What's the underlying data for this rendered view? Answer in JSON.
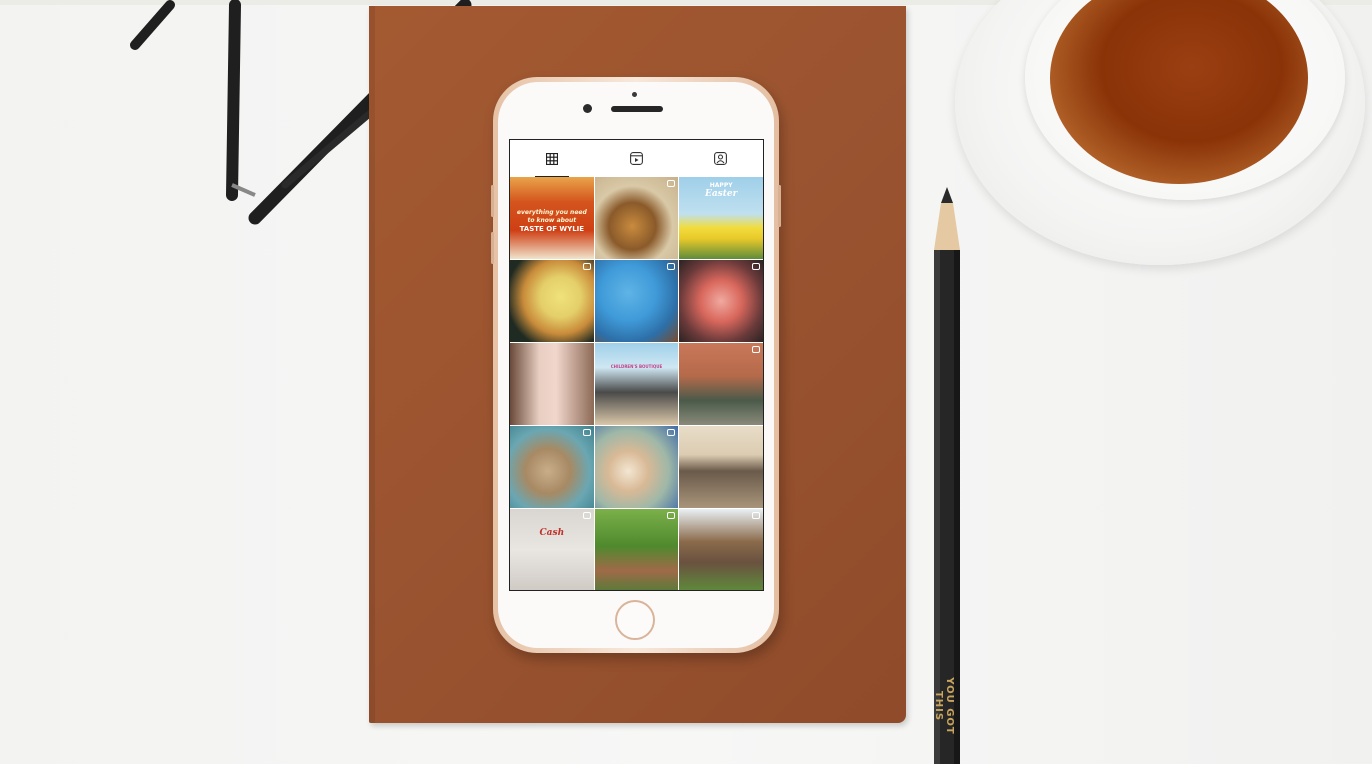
{
  "scene": {
    "pencil_text": "YOU GOT THIS"
  },
  "profile_tabs": [
    {
      "icon": "grid-icon",
      "active": true
    },
    {
      "icon": "reels-icon",
      "active": false
    },
    {
      "icon": "tagged-icon",
      "active": false
    }
  ],
  "posts": [
    {
      "id": "taste-of-wylie",
      "line1": "everything you need",
      "line2": "to know about",
      "line3": "TASTE OF WYLIE",
      "badge": false
    },
    {
      "id": "food-platter",
      "badge": true
    },
    {
      "id": "happy-easter",
      "line1": "HAPPY",
      "line2": "Easter",
      "badge": false
    },
    {
      "id": "waffle-cone-ice-cream",
      "badge": true
    },
    {
      "id": "blue-table-setting",
      "badge": true
    },
    {
      "id": "strawberry-drinks",
      "badge": true
    },
    {
      "id": "boutique-dress",
      "badge": false
    },
    {
      "id": "childrens-boutique",
      "line1": "CHILDREN'S BOUTIQUE",
      "badge": false
    },
    {
      "id": "storefront",
      "badge": true
    },
    {
      "id": "cowboy-hat",
      "badge": true
    },
    {
      "id": "coffee-latte",
      "badge": true
    },
    {
      "id": "vintage-photo",
      "badge": false
    },
    {
      "id": "embroidered-sweatshirt",
      "line1": "Cash",
      "badge": true
    },
    {
      "id": "garden-bridge",
      "badge": true
    },
    {
      "id": "horse-stable",
      "badge": true
    }
  ]
}
